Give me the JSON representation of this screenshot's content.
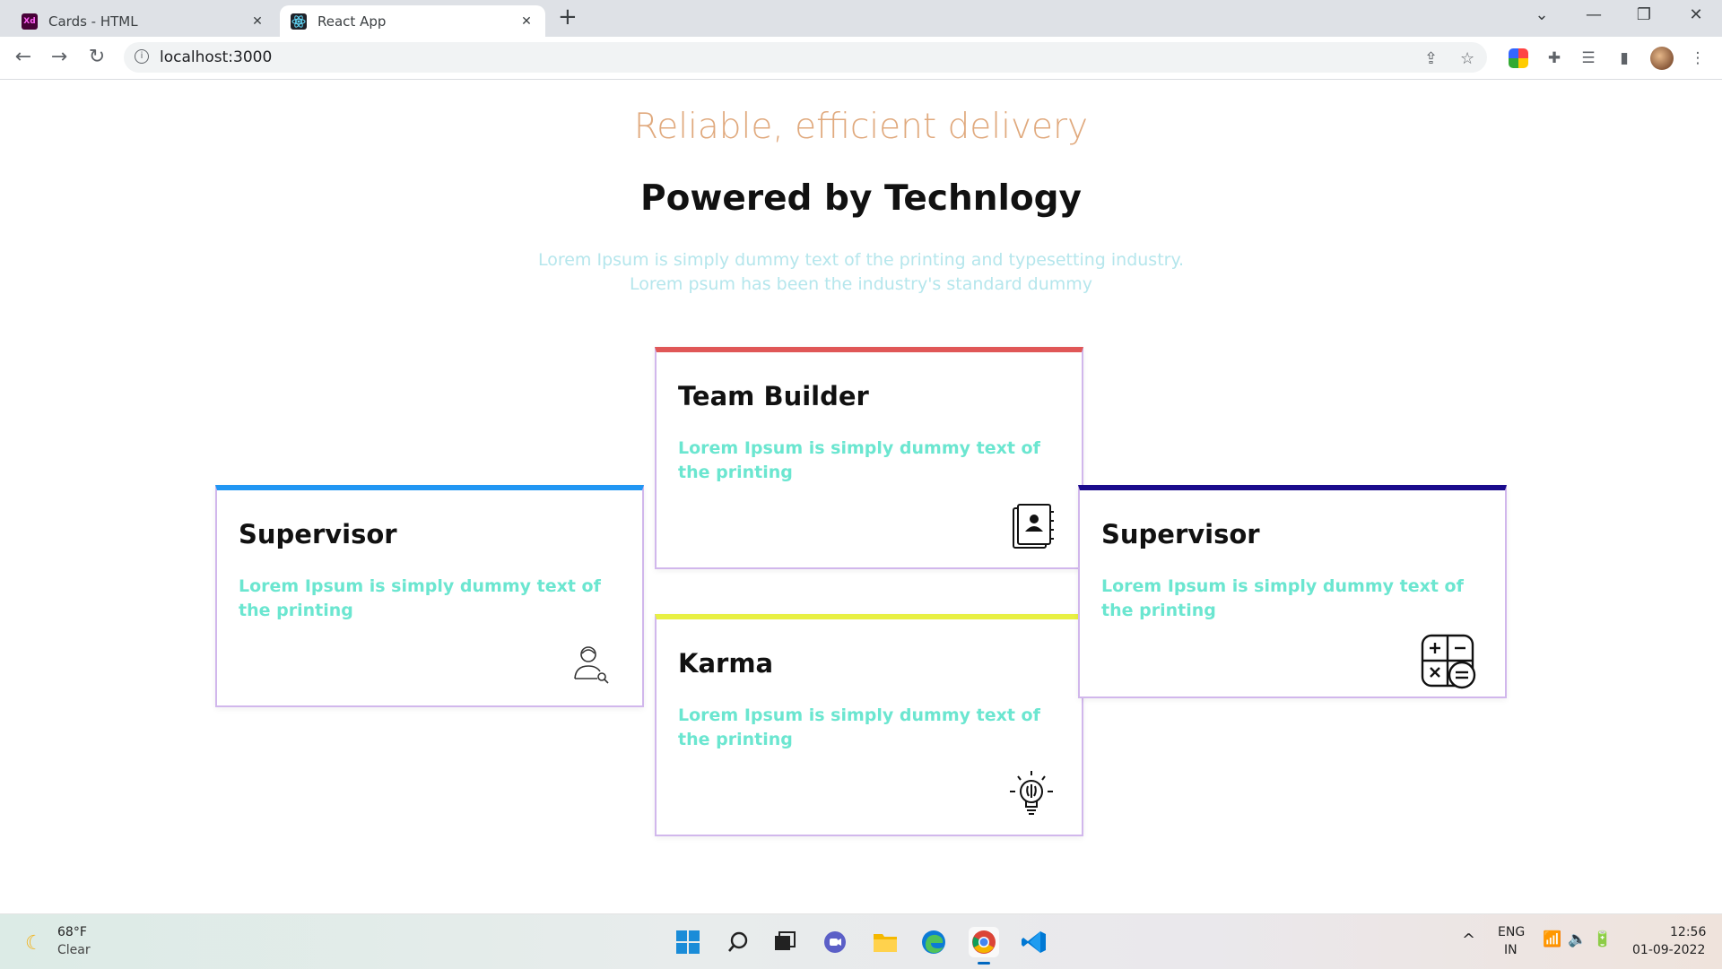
{
  "browser": {
    "tabs": [
      {
        "title": "Cards - HTML",
        "favicon": "adobe-xd-icon",
        "active": false
      },
      {
        "title": "React App",
        "favicon": "react-icon",
        "active": true
      }
    ],
    "url": "localhost:3000",
    "favicon_xd_text": "Xd"
  },
  "page": {
    "subtitle": "Reliable, efficient delivery",
    "heading": "Powered by Technlogy",
    "intro_line1": "Lorem Ipsum is simply dummy text of the printing and typesetting industry.",
    "intro_line2": "Lorem psum has been the industry's standard dummy",
    "cards": [
      {
        "title": "Supervisor",
        "text": "Lorem Ipsum is simply dummy text of the printing",
        "accent": "#2196f3",
        "icon": "user-search-icon"
      },
      {
        "title": "Team Builder",
        "text": "Lorem Ipsum is simply dummy text of the printing",
        "accent": "#e05757",
        "icon": "contact-book-icon"
      },
      {
        "title": "Karma",
        "text": "Lorem Ipsum is simply dummy text of the printing",
        "accent": "#e8f043",
        "icon": "lightbulb-brain-icon"
      },
      {
        "title": "Supervisor",
        "text": "Lorem Ipsum is simply dummy text of the printing",
        "accent": "#1a0b8c",
        "icon": "calculator-icon"
      }
    ]
  },
  "taskbar": {
    "weather_temp": "68°F",
    "weather_cond": "Clear",
    "lang_line1": "ENG",
    "lang_line2": "IN",
    "time": "12:56",
    "date": "01-09-2022"
  },
  "colors": {
    "subtitle": "#e0a97d",
    "intro": "#b5e6ec",
    "card_text": "#6be6d0",
    "card_border": "#d1b7ec"
  }
}
